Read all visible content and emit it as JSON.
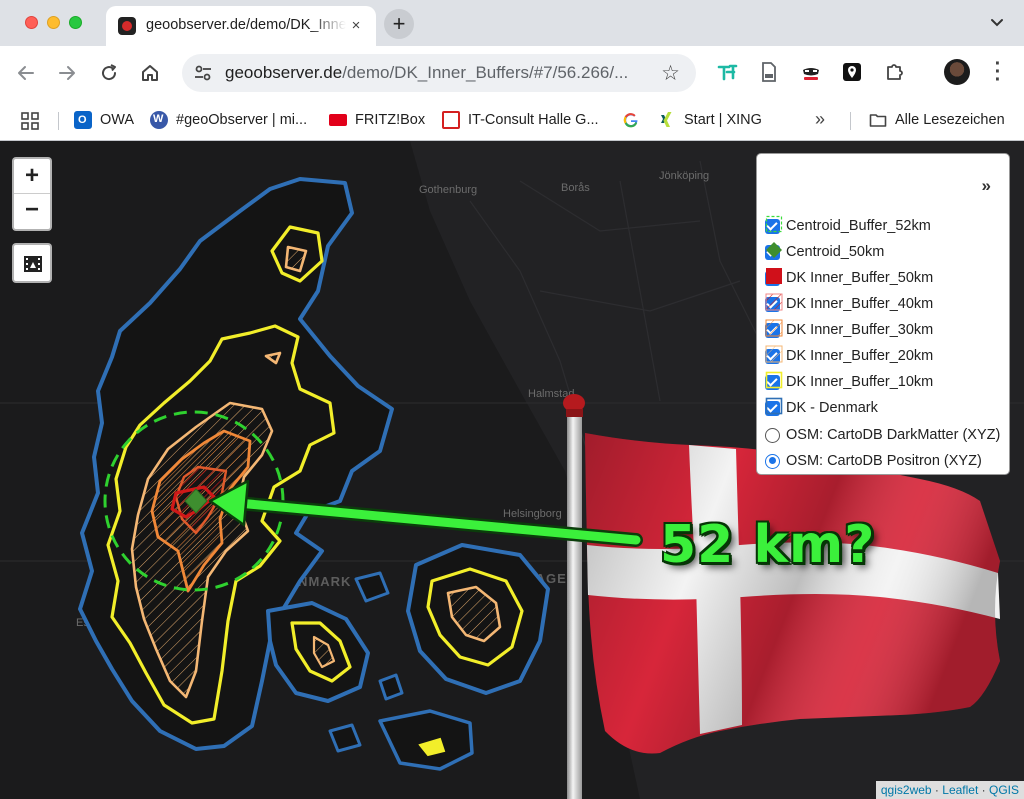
{
  "browser": {
    "tab_title": "geoobserver.de/demo/DK_Inner_Buffers",
    "tab_close": "×",
    "new_tab": "+",
    "url_host": "geoobserver.de",
    "url_path": "/demo/DK_Inner_Buffers/#7/56.266/...",
    "bookmarks": [
      {
        "label": "OWA"
      },
      {
        "label": "#geoObserver | mi..."
      },
      {
        "label": "FRITZ!Box"
      },
      {
        "label": "IT-Consult Halle G..."
      },
      {
        "label": ""
      },
      {
        "label": "Start | XING"
      }
    ],
    "more_bookmarks": "»",
    "all_bookmarks": "Alle Lesezeichen"
  },
  "map": {
    "zoom_in": "+",
    "zoom_out": "−",
    "cities": [
      "Gothenburg",
      "Borås",
      "Jönköping",
      "Halmstad",
      "Helsingborg",
      "DENMARK",
      "COPENHAGEN",
      "Esbjerg"
    ],
    "annotation": "52 km?",
    "attribution": {
      "qgis2web": "qgis2web",
      "sep1": "·",
      "leaflet": "Leaflet",
      "sep2": "·",
      "qgis": "QGIS"
    }
  },
  "layers": {
    "expand": "»",
    "items": [
      {
        "label": "Centroid_Buffer_52km",
        "type": "checkbox",
        "checked": true,
        "swatch": "dashed-green"
      },
      {
        "label": "Centroid_50km",
        "type": "checkbox",
        "checked": true,
        "swatch": "green-diamond"
      },
      {
        "label": "DK Inner_Buffer_50km",
        "type": "checkbox",
        "checked": true,
        "swatch": "red"
      },
      {
        "label": "DK Inner_Buffer_40km",
        "type": "checkbox",
        "checked": true,
        "swatch": "hatched-red"
      },
      {
        "label": "DK Inner_Buffer_30km",
        "type": "checkbox",
        "checked": true,
        "swatch": "hatched-orange"
      },
      {
        "label": "DK Inner_Buffer_20km",
        "type": "checkbox",
        "checked": true,
        "swatch": "hatched-lightorange"
      },
      {
        "label": "DK Inner_Buffer_10km",
        "type": "checkbox",
        "checked": true,
        "swatch": "yellow-outline"
      },
      {
        "label": "DK - Denmark",
        "type": "checkbox",
        "checked": true,
        "swatch": "blue-outline"
      },
      {
        "label": "OSM: CartoDB DarkMatter (XYZ)",
        "type": "radio",
        "checked": false
      },
      {
        "label": "OSM: CartoDB Positron (XYZ)",
        "type": "radio",
        "checked": true
      }
    ]
  },
  "colors": {
    "denmark_outline": "#2f6fb5",
    "buffer_10": "#f2ee2a",
    "buffer_20": "#f4b774",
    "buffer_30": "#f08838",
    "buffer_40": "#e05a2c",
    "buffer_50": "#d01818",
    "centroid": "#3e8e2f",
    "annotation": "#3bf03b"
  }
}
